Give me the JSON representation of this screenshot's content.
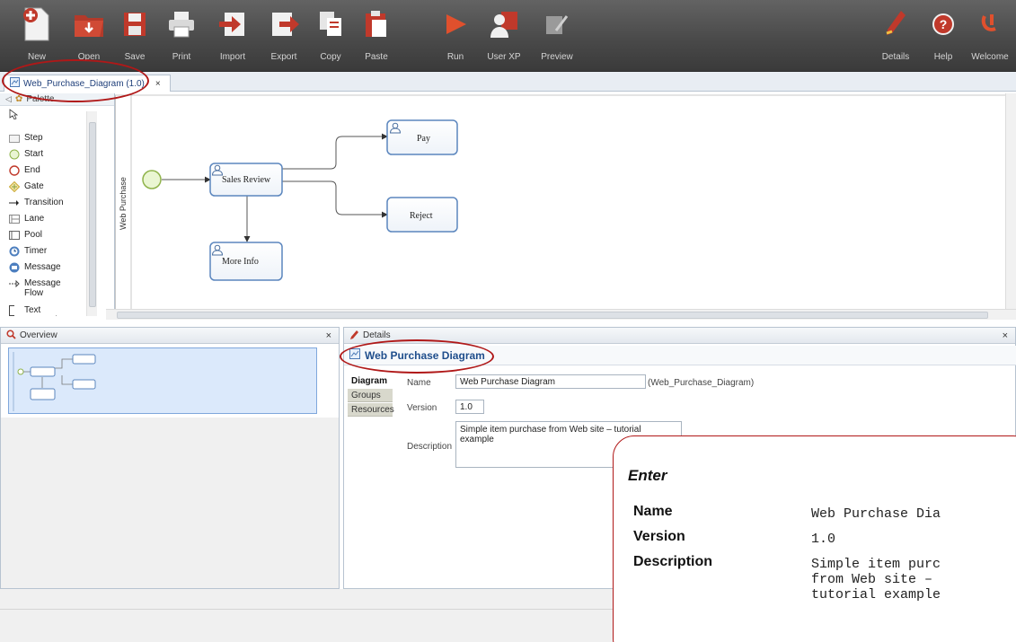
{
  "toolbar": {
    "items": [
      {
        "label": "New",
        "icon": "new-document-icon"
      },
      {
        "label": "Open",
        "icon": "open-folder-icon"
      },
      {
        "label": "Save",
        "icon": "save-disk-icon"
      },
      {
        "label": "Print",
        "icon": "printer-icon"
      },
      {
        "label": "Import",
        "icon": "import-icon"
      },
      {
        "label": "Export",
        "icon": "export-icon"
      },
      {
        "label": "Copy",
        "icon": "copy-icon"
      },
      {
        "label": "Paste",
        "icon": "paste-icon"
      },
      {
        "label": "Run",
        "icon": "run-play-icon"
      },
      {
        "label": "User XP",
        "icon": "user-xp-icon"
      },
      {
        "label": "Preview",
        "icon": "preview-icon"
      },
      {
        "label": "Details",
        "icon": "pencil-icon"
      },
      {
        "label": "Help",
        "icon": "help-icon"
      },
      {
        "label": "Welcome",
        "icon": "welcome-icon"
      }
    ],
    "colors": {
      "accent_red": "#c0392b",
      "background": "#4a4a4a"
    }
  },
  "tab": {
    "label": "Web_Purchase_Diagram (1.0)",
    "close": "×"
  },
  "palette": {
    "header": "Palette",
    "items": [
      {
        "label": "Step",
        "icon": "step-icon"
      },
      {
        "label": "Start",
        "icon": "start-icon"
      },
      {
        "label": "End",
        "icon": "end-icon"
      },
      {
        "label": "Gate",
        "icon": "gate-icon"
      },
      {
        "label": "Transition",
        "icon": "transition-icon"
      },
      {
        "label": "Lane",
        "icon": "lane-icon"
      },
      {
        "label": "Pool",
        "icon": "pool-icon"
      },
      {
        "label": "Timer",
        "icon": "timer-icon"
      },
      {
        "label": "Message",
        "icon": "message-icon"
      },
      {
        "label": "Message Flow",
        "icon": "message-flow-icon"
      },
      {
        "label": "Text Annotation",
        "icon": "text-annotation-icon"
      }
    ]
  },
  "diagram": {
    "lane_label": "Web Purchase",
    "steps": {
      "sales_review": "Sales Review",
      "pay": "Pay",
      "reject": "Reject",
      "more_info": "More Info"
    }
  },
  "overview": {
    "title": "Overview",
    "close": "×"
  },
  "details": {
    "panel_title": "Details",
    "close": "×",
    "diagram_title": "Web Purchase Diagram",
    "tabs": [
      "Diagram",
      "Groups",
      "Resources"
    ],
    "fields": {
      "name_label": "Name",
      "name_value": "Web Purchase Diagram",
      "name_id": "(Web_Purchase_Diagram)",
      "version_label": "Version",
      "version_value": "1.0",
      "description_label": "Description",
      "description_value": "Simple item purchase from Web site – tutorial example"
    }
  },
  "callout": {
    "title": "Enter",
    "rows": [
      {
        "label": "Name",
        "value": "Web Purchase Dia"
      },
      {
        "label": "Version",
        "value": "1.0"
      },
      {
        "label": "Description",
        "value_lines": [
          "Simple item purc",
          "from Web site –",
          "tutorial example"
        ]
      }
    ]
  }
}
